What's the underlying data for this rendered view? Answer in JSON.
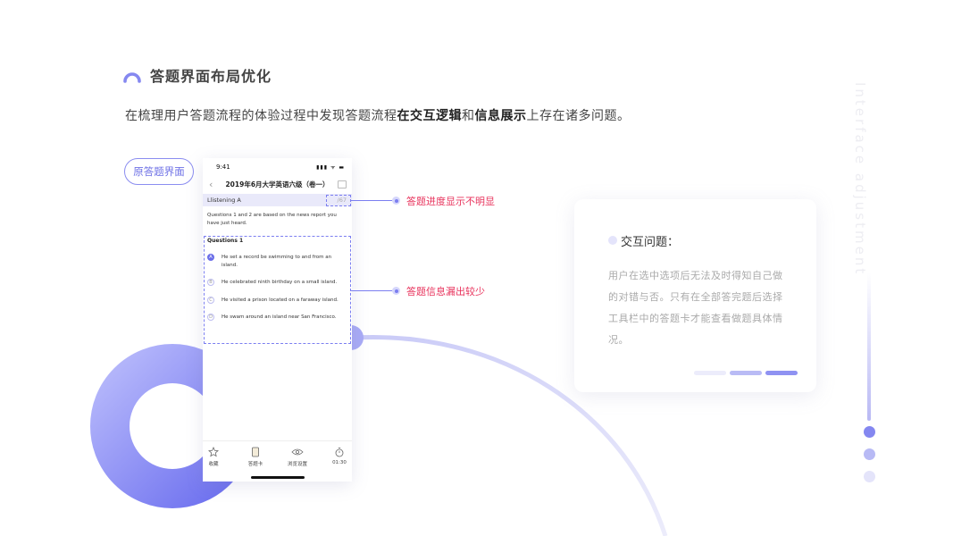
{
  "header": {
    "title": "答题界面布局优化",
    "intro_prefix": "在梳理用户答题流程的体验过程中发现答题流程",
    "intro_bold1": "在交互逻辑",
    "intro_mid": "和",
    "intro_bold2": "信息展示",
    "intro_suffix": "上存在诸多问题。"
  },
  "original_tag": "原答题界面",
  "phone": {
    "status_time": "9:41",
    "status_icons": "▮▮▮ ᯤ ▬",
    "exam_title": "2019年6月大学英语六级（卷一）",
    "section_label": "Llistening A",
    "progress": "/67",
    "instruction": "Questions 1 and 2 are based on the news report you have just heard.",
    "question_title": "Questions 1",
    "options": [
      {
        "letter": "A",
        "text": "He set a record be swimming to and from an island."
      },
      {
        "letter": "B",
        "text": "He celebrated ninth birthday on a small island."
      },
      {
        "letter": "C",
        "text": "He visited a prison located on a faraway island."
      },
      {
        "letter": "D",
        "text": "He swam around an island near San Francisco."
      }
    ],
    "toolbar": [
      {
        "label": "收藏",
        "icon": "star-icon"
      },
      {
        "label": "答题卡",
        "icon": "answer-card-icon"
      },
      {
        "label": "浏览设置",
        "icon": "eye-icon"
      },
      {
        "label": "01:30",
        "icon": "timer-icon"
      }
    ]
  },
  "callouts": {
    "progress_issue": "答题进度显示不明显",
    "info_issue": "答题信息漏出较少"
  },
  "card": {
    "title": "交互问题：",
    "body": "用户在选中选项后无法及时得知自己做的对错与否。只有在全部答完题后选择工具栏中的答题卡才能查看做题具体情况。"
  },
  "side_text": "Interface adjustment",
  "colors": {
    "accent": "#7b7ef0",
    "highlight": "#e8335c",
    "section_bg": "#e9e9fa"
  }
}
